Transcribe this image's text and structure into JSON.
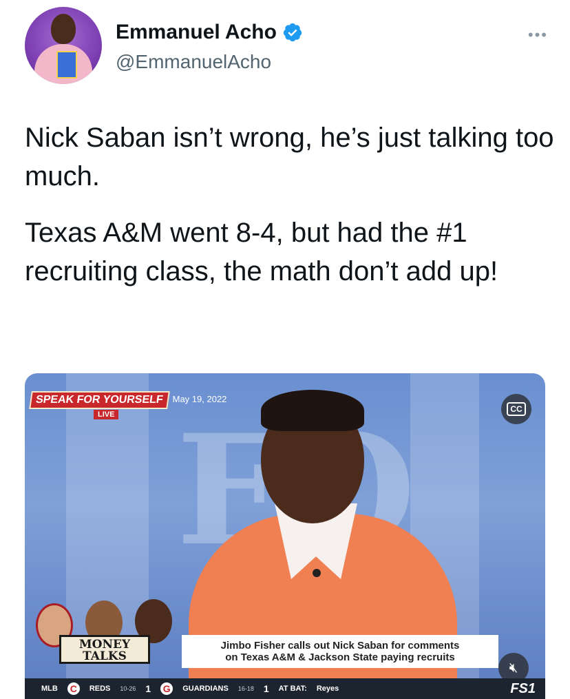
{
  "tweet": {
    "display_name": "Emmanuel Acho",
    "handle": "@EmmanuelAcho",
    "more_label": "•••",
    "paragraphs": [
      "Nick Saban isn’t wrong, he’s just talking too much.",
      "Texas A&M went 8-4, but had the #1 recruiting class, the math don’t add up!"
    ]
  },
  "video": {
    "show_logo": "SPEAK FOR YOURSELF",
    "date": "May 19, 2022",
    "live": "LIVE",
    "cc_label": "CC",
    "money_talks": [
      "MONEY",
      "TALKS"
    ],
    "headline_line1": "Jimbo Fisher calls out Nick Saban for comments",
    "headline_line2": "on Texas A&M & Jackson State paying recruits",
    "mute_icon": "volume-muted-icon",
    "ticker": {
      "league": "MLB",
      "team1": "REDS",
      "team1_record": "10-26",
      "team1_score": "1",
      "team2": "GUARDIANS",
      "team2_record": "16-18",
      "team2_score": "1",
      "at_bat": "AT BAT:",
      "batter": "Reyes",
      "network": "FS1"
    }
  },
  "colors": {
    "verified": "#1d9bf0",
    "handle": "#536471",
    "live": "#c8282b",
    "shirt": "#f07f52"
  }
}
